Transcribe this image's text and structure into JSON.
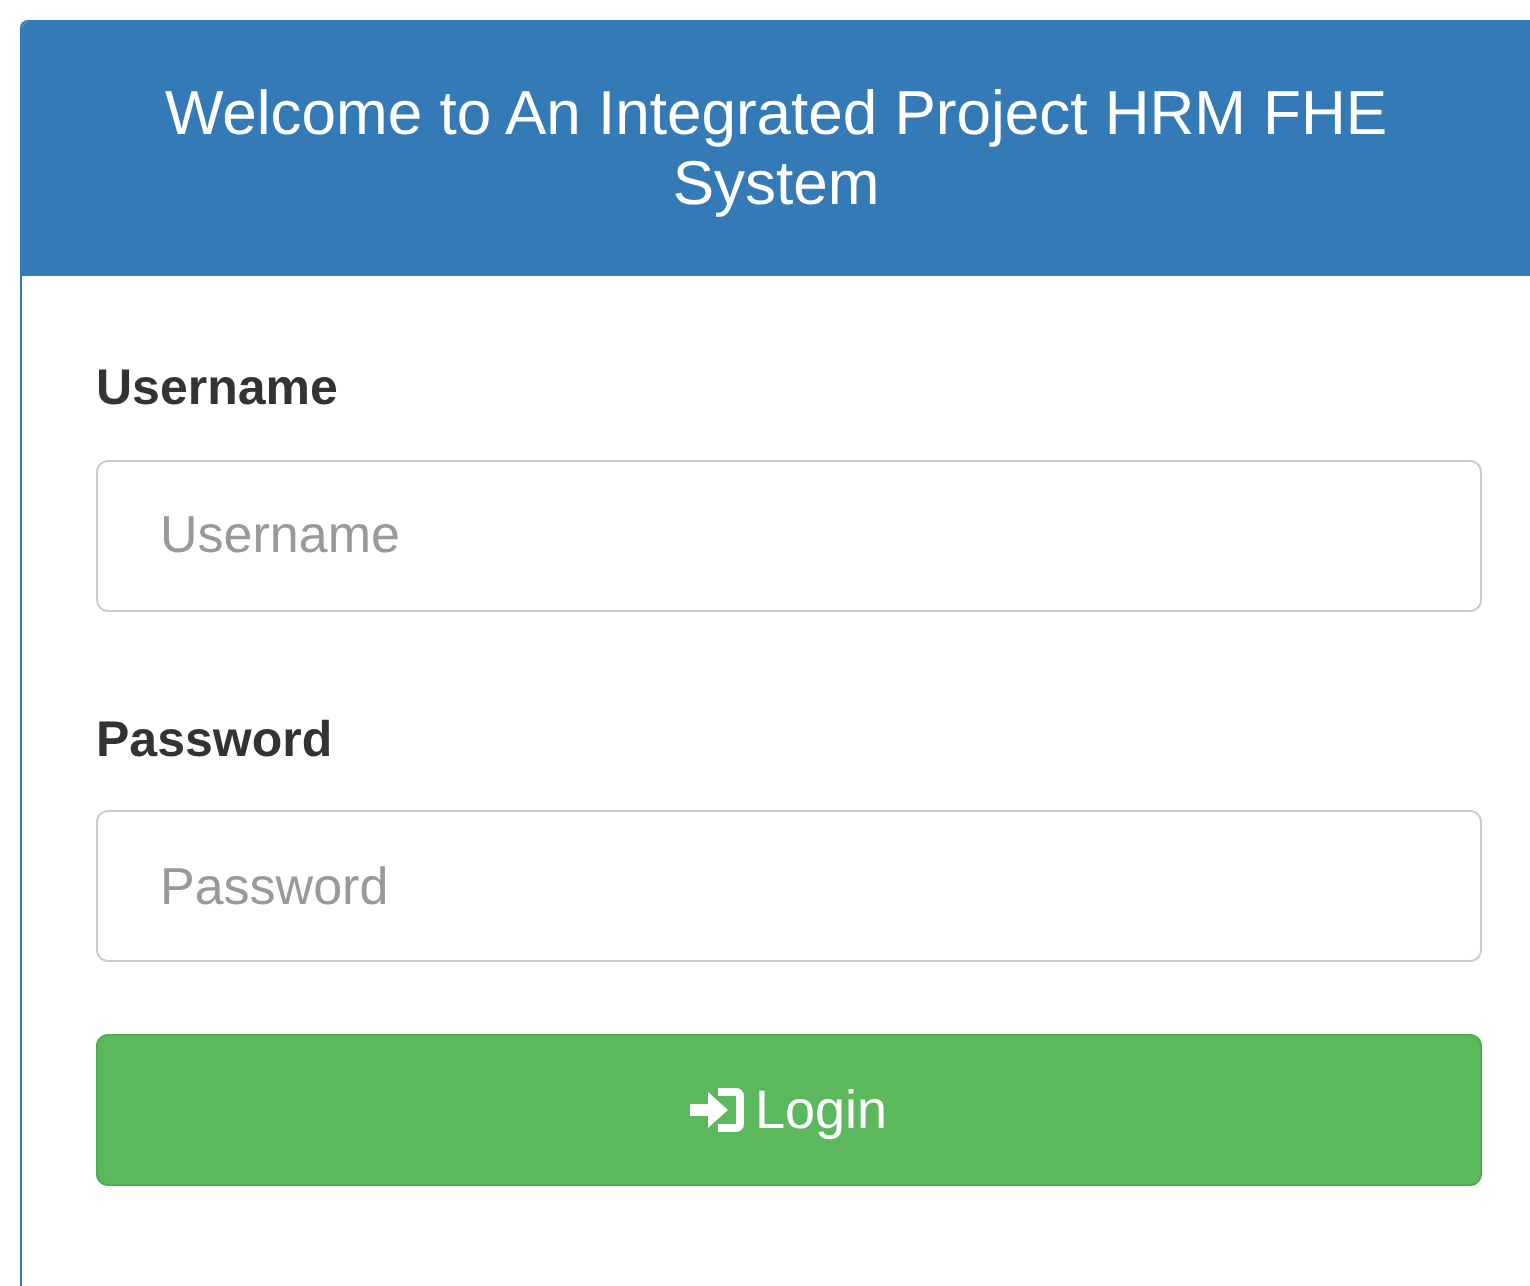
{
  "panel": {
    "title": "Welcome to An Integrated Project HRM FHE System"
  },
  "fields": [
    {
      "label": "Username",
      "placeholder": "Username"
    },
    {
      "label": "Password",
      "placeholder": "Password"
    }
  ],
  "button": {
    "label": "Login"
  }
}
